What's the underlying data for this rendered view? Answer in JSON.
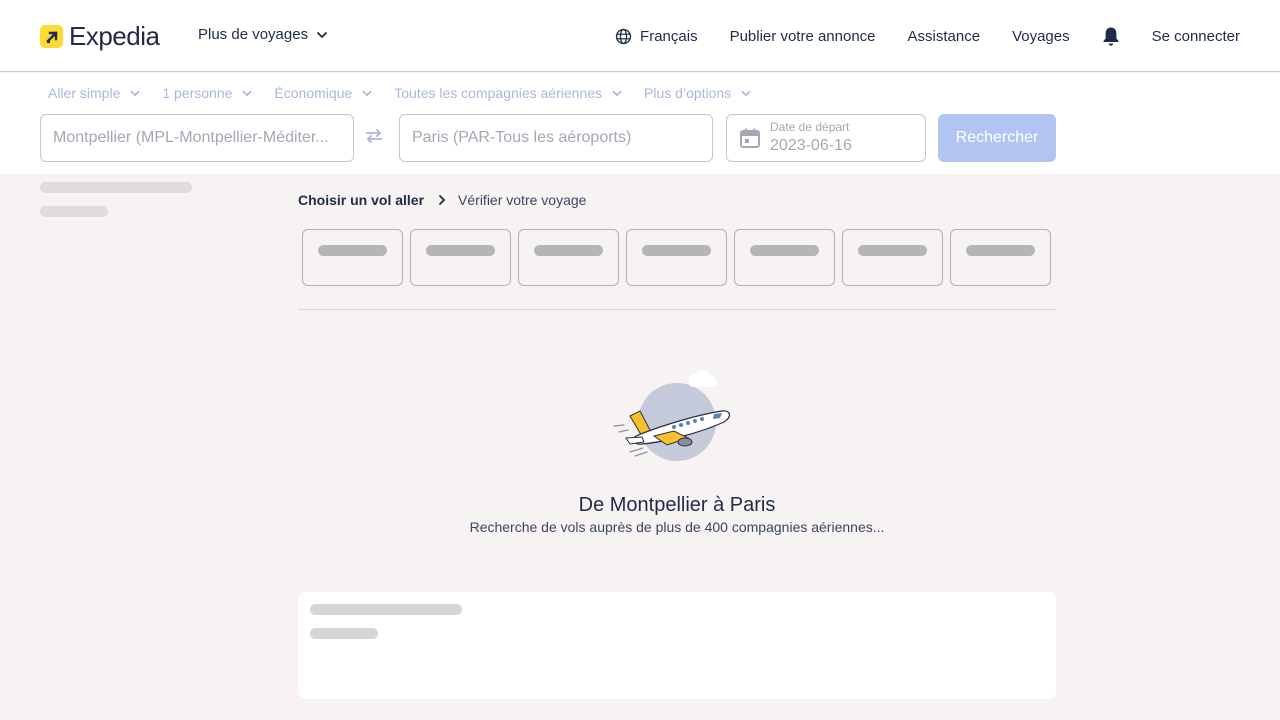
{
  "header": {
    "logo_text": "Expedia",
    "more_trips": "Plus de voyages",
    "nav": {
      "language": "Français",
      "list_property": "Publier votre annonce",
      "support": "Assistance",
      "trips": "Voyages",
      "sign_in": "Se connecter"
    }
  },
  "search": {
    "filters": {
      "trip_type": "Aller simple",
      "travelers": "1 personne",
      "cabin_class": "Économique",
      "airlines": "Toutes les compagnies aériennes",
      "more_options": "Plus d’options"
    },
    "origin": "Montpellier (MPL-Montpellier-Méditer...",
    "destination": "Paris (PAR-Tous les aéroports)",
    "date_label": "Date de départ",
    "date_value": "2023-06-16",
    "search_button": "Rechercher"
  },
  "breadcrumb": {
    "step1": "Choisir un vol aller",
    "step2": "Vérifier votre voyage"
  },
  "loading": {
    "title": "De Montpellier à Paris",
    "subtitle": "Recherche de vols auprès de plus de 400 compagnies aériennes..."
  },
  "colors": {
    "brand_yellow": "#fddb32",
    "navy": "#1f2b49",
    "search_button": "#b2c4f1",
    "page_background": "#f6f3f2"
  }
}
